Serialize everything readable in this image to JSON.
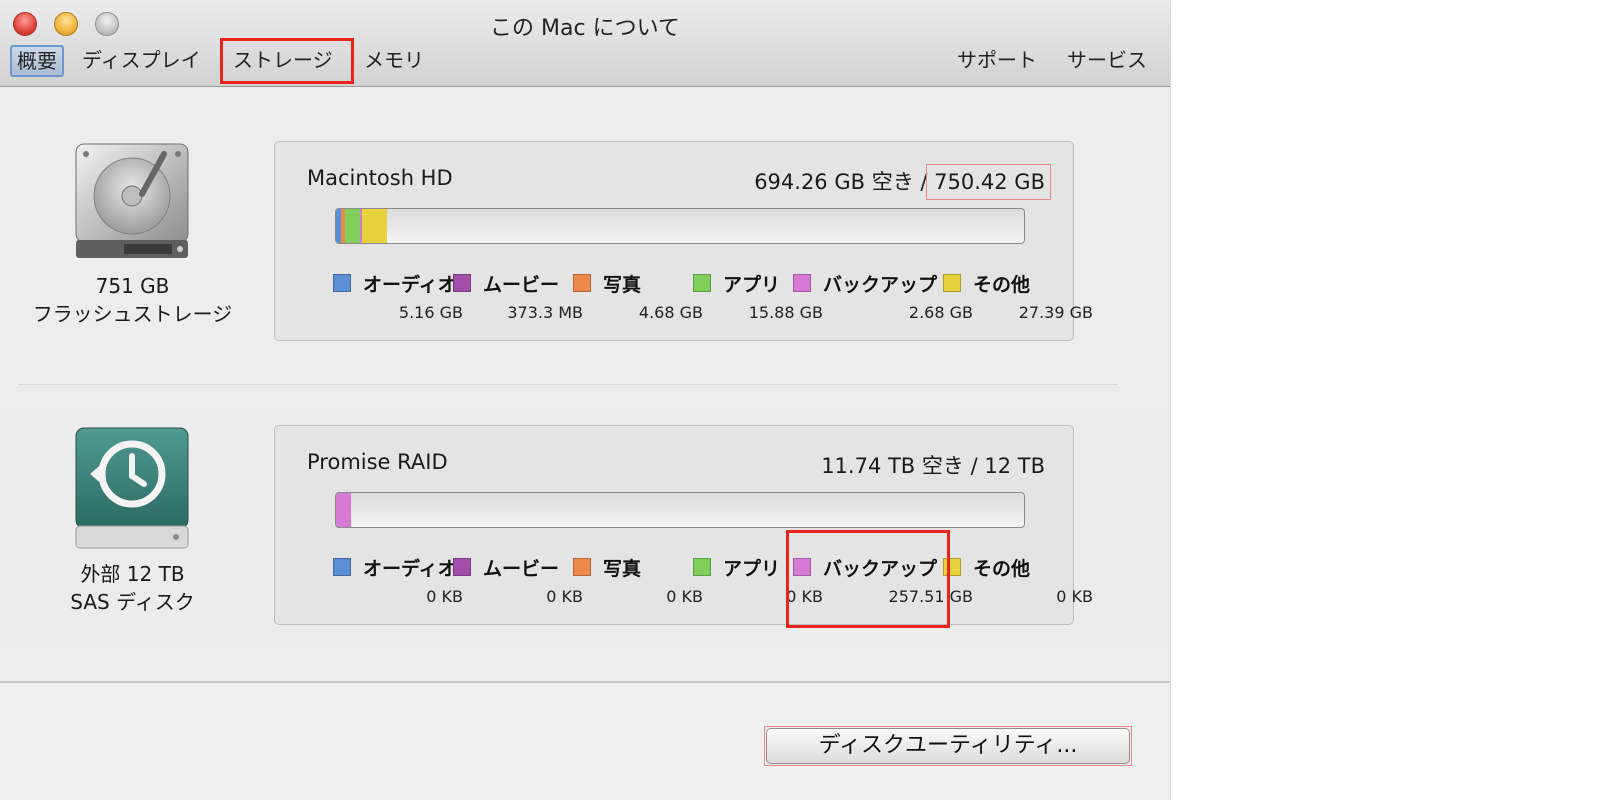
{
  "window": {
    "title": "この Mac について",
    "tabs": [
      "概要",
      "ディスプレイ",
      "ストレージ",
      "メモリ"
    ],
    "right_tabs": [
      "サポート",
      "サービス"
    ],
    "selected_tab": "概要",
    "highlighted_tab": "ストレージ"
  },
  "drives": [
    {
      "icon": "hard-drive-icon",
      "capacity_label": "751 GB",
      "type_label": "フラッシュストレージ",
      "name": "Macintosh HD",
      "free": "694.26 GB 空き",
      "separator": "/",
      "total": "750.42 GB",
      "categories": [
        {
          "label": "オーディオ",
          "value": "5.16 GB",
          "color": "#5b8fd6",
          "usage_fraction": 0.0069
        },
        {
          "label": "ムービー",
          "value": "373.3 MB",
          "color": "#a34ea8",
          "usage_fraction": 0.0005
        },
        {
          "label": "写真",
          "value": "4.68 GB",
          "color": "#f0884e",
          "usage_fraction": 0.0062
        },
        {
          "label": "アプリ",
          "value": "15.88 GB",
          "color": "#7fcf5a",
          "usage_fraction": 0.0212
        },
        {
          "label": "バックアップ",
          "value": "2.68 GB",
          "color": "#d67ad6",
          "usage_fraction": 0.0036
        },
        {
          "label": "その他",
          "value": "27.39 GB",
          "color": "#e6d23c",
          "usage_fraction": 0.0365
        }
      ]
    },
    {
      "icon": "time-machine-drive-icon",
      "capacity_label": "外部 12 TB",
      "type_label": "SAS ディスク",
      "name": "Promise RAID",
      "free": "11.74 TB 空き",
      "separator": "/",
      "total": "12 TB",
      "categories": [
        {
          "label": "オーディオ",
          "value": "0 KB",
          "color": "#5b8fd6",
          "usage_fraction": 0
        },
        {
          "label": "ムービー",
          "value": "0 KB",
          "color": "#a34ea8",
          "usage_fraction": 0
        },
        {
          "label": "写真",
          "value": "0 KB",
          "color": "#f0884e",
          "usage_fraction": 0
        },
        {
          "label": "アプリ",
          "value": "0 KB",
          "color": "#7fcf5a",
          "usage_fraction": 0
        },
        {
          "label": "バックアップ",
          "value": "257.51 GB",
          "color": "#d67ad6",
          "usage_fraction": 0.0215
        },
        {
          "label": "その他",
          "value": "0 KB",
          "color": "#e6d23c",
          "usage_fraction": 0
        }
      ]
    }
  ],
  "disk_utility_button": "ディスクユーティリティ..."
}
